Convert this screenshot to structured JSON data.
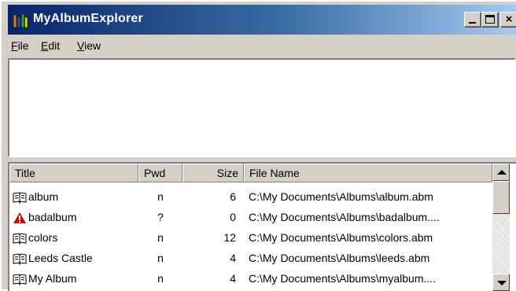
{
  "window": {
    "title": "MyAlbumExplorer"
  },
  "menu": [
    {
      "accel": "F",
      "rest": "ile"
    },
    {
      "accel": "E",
      "rest": "dit"
    },
    {
      "accel": "V",
      "rest": "iew"
    }
  ],
  "list": {
    "columns": [
      "Title",
      "Pwd",
      "Size",
      "File Name"
    ],
    "rows": [
      {
        "icon": "book-icon",
        "title": "album",
        "pwd": "n",
        "size": "6",
        "file": "C:\\My Documents\\Albums\\album.abm"
      },
      {
        "icon": "warning-icon",
        "title": "badalbum",
        "pwd": "?",
        "size": "0",
        "file": "C:\\My Documents\\Albums\\badalbum...."
      },
      {
        "icon": "book-icon",
        "title": "colors",
        "pwd": "n",
        "size": "12",
        "file": "C:\\My Documents\\Albums\\colors.abm"
      },
      {
        "icon": "book-icon",
        "title": "Leeds Castle",
        "pwd": "n",
        "size": "4",
        "file": "C:\\My Documents\\Albums\\leeds.abm"
      },
      {
        "icon": "book-icon",
        "title": "My Album",
        "pwd": "n",
        "size": "4",
        "file": "C:\\My Documents\\Albums\\myalbum...."
      }
    ]
  },
  "colors": {
    "titlebar_start": "#0a246a",
    "titlebar_end": "#a6caf0",
    "chrome": "#d4d0c8",
    "warning": "#e00000"
  }
}
